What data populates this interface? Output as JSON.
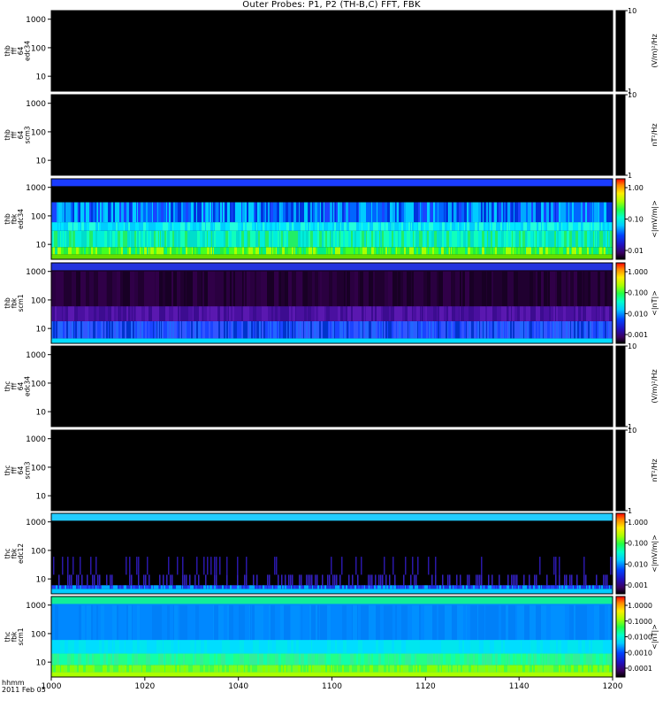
{
  "title": "Outer Probes: P1, P2 (TH-B,C) FFT, FBK",
  "x_axis": {
    "label_line1": "hhmm",
    "label_line2": "2011 Feb 05",
    "ticks": [
      "1000",
      "1020",
      "1040",
      "1100",
      "1120",
      "1140",
      "1200"
    ]
  },
  "chart_data": [
    {
      "type": "heatmap",
      "panel": 1,
      "ylabel": [
        "thb",
        "fff",
        "64",
        "edc34"
      ],
      "yticks": [
        "10",
        "100",
        "1000"
      ],
      "colorbar": {
        "label": "(V/m)²/Hz",
        "ticks": [
          "1",
          "10"
        ],
        "scale": "black"
      },
      "pattern": "empty"
    },
    {
      "type": "heatmap",
      "panel": 2,
      "ylabel": [
        "thb",
        "fff",
        "64",
        "scm3"
      ],
      "yticks": [
        "10",
        "100",
        "1000"
      ],
      "colorbar": {
        "label": "nT²/Hz",
        "ticks": [
          "1",
          "10"
        ],
        "scale": "black"
      },
      "pattern": "empty"
    },
    {
      "type": "heatmap",
      "panel": 3,
      "ylabel": [
        "thb",
        "fbk",
        "edc34"
      ],
      "yticks": [
        "10",
        "100",
        "1000"
      ],
      "colorbar": {
        "label": "<|mV/m|>",
        "ticks": [
          "0.01",
          "0.10",
          "1.00"
        ],
        "scale": "rainbow"
      },
      "pattern": "thb_edc"
    },
    {
      "type": "heatmap",
      "panel": 4,
      "ylabel": [
        "thb",
        "fbk",
        "scm1"
      ],
      "yticks": [
        "10",
        "100",
        "1000"
      ],
      "colorbar": {
        "label": "<|nT|>",
        "ticks": [
          "0.001",
          "0.010",
          "0.100",
          "1.000"
        ],
        "scale": "rainbow"
      },
      "pattern": "thb_scm"
    },
    {
      "type": "heatmap",
      "panel": 5,
      "ylabel": [
        "thc",
        "fff",
        "64",
        "edc34"
      ],
      "yticks": [
        "10",
        "100",
        "1000"
      ],
      "colorbar": {
        "label": "(V/m)²/Hz",
        "ticks": [
          "1",
          "10"
        ],
        "scale": "black"
      },
      "pattern": "empty"
    },
    {
      "type": "heatmap",
      "panel": 6,
      "ylabel": [
        "thc",
        "fff",
        "64",
        "scm3"
      ],
      "yticks": [
        "10",
        "100",
        "1000"
      ],
      "colorbar": {
        "label": "nT²/Hz",
        "ticks": [
          "1",
          "10"
        ],
        "scale": "black"
      },
      "pattern": "empty"
    },
    {
      "type": "heatmap",
      "panel": 7,
      "ylabel": [
        "thc",
        "fbk",
        "edc12"
      ],
      "yticks": [
        "10",
        "100",
        "1000"
      ],
      "colorbar": {
        "label": "<|mV/m|>",
        "ticks": [
          "0.001",
          "0.010",
          "0.100",
          "1.000"
        ],
        "scale": "rainbow"
      },
      "pattern": "thc_edc"
    },
    {
      "type": "heatmap",
      "panel": 8,
      "ylabel": [
        "thc",
        "fbk",
        "scm1"
      ],
      "yticks": [
        "10",
        "100",
        "1000"
      ],
      "colorbar": {
        "label": "<|nT|>",
        "ticks": [
          "0.0001",
          "0.0010",
          "0.0100",
          "0.1000",
          "1.0000"
        ],
        "scale": "rainbow"
      },
      "pattern": "thc_scm"
    }
  ]
}
